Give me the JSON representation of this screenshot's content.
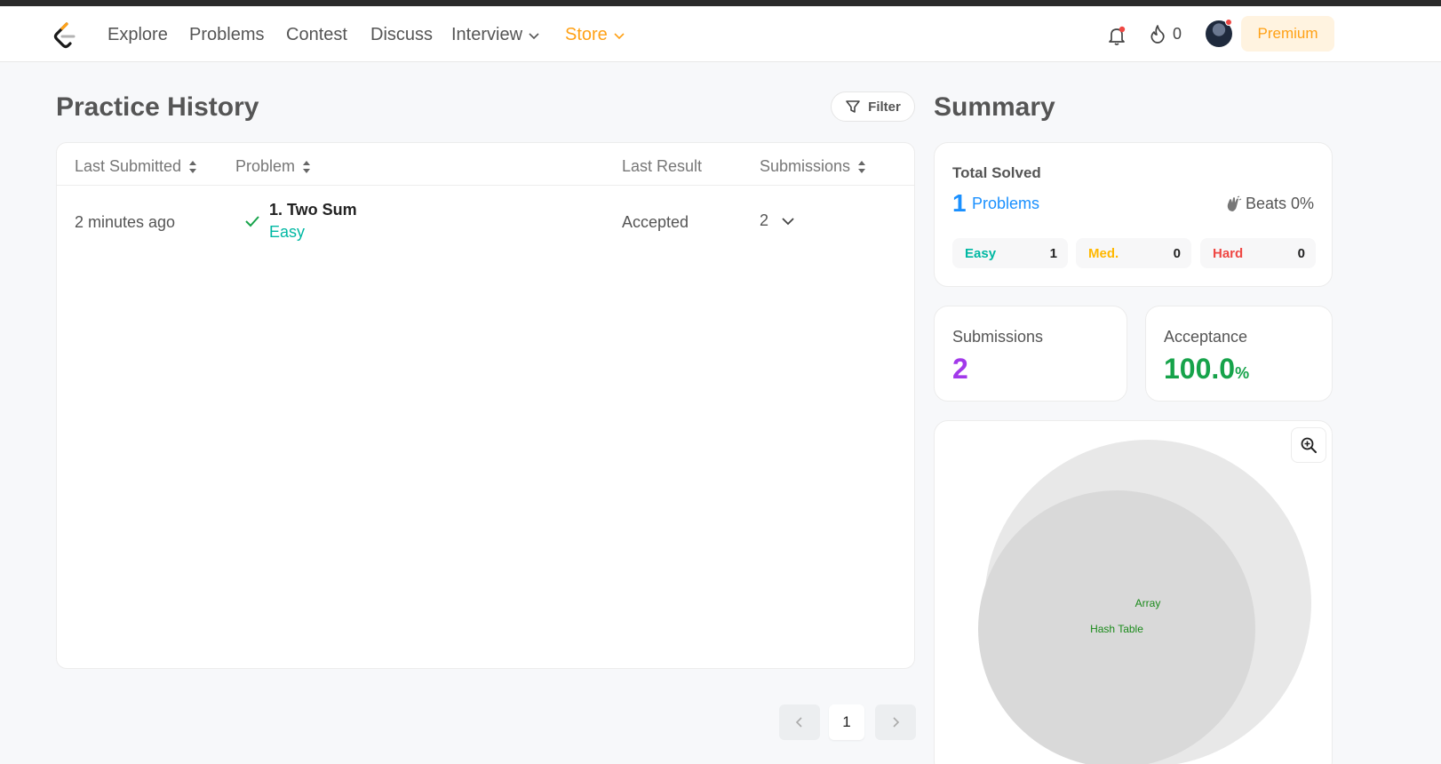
{
  "nav": {
    "items": [
      {
        "label": "Explore"
      },
      {
        "label": "Problems"
      },
      {
        "label": "Contest"
      },
      {
        "label": "Discuss"
      },
      {
        "label": "Interview"
      },
      {
        "label": "Store"
      }
    ],
    "streak_count": "0",
    "premium_label": "Premium"
  },
  "history": {
    "title": "Practice History",
    "filter_label": "Filter",
    "columns": {
      "last_submitted": "Last Submitted",
      "problem": "Problem",
      "last_result": "Last Result",
      "submissions": "Submissions"
    },
    "rows": [
      {
        "last_submitted": "2 minutes ago",
        "problem_title": "1. Two Sum",
        "difficulty": "Easy",
        "last_result": "Accepted",
        "submissions": "2"
      }
    ],
    "pagination": {
      "current_page": "1"
    }
  },
  "summary": {
    "title": "Summary",
    "total_solved": {
      "label": "Total Solved",
      "count": "1",
      "unit": "Problems",
      "beats": "Beats 0%"
    },
    "difficulty": [
      {
        "label": "Easy",
        "count": "1",
        "color": "#00b8a3"
      },
      {
        "label": "Med.",
        "count": "0",
        "color": "#ffb800"
      },
      {
        "label": "Hard",
        "count": "0",
        "color": "#ef4743"
      }
    ],
    "submissions": {
      "label": "Submissions",
      "value": "2",
      "color": "#a239ea"
    },
    "acceptance": {
      "label": "Acceptance",
      "value": "100.0",
      "unit": "%",
      "color": "#16a34a"
    },
    "tags": [
      "Array",
      "Hash Table"
    ]
  },
  "colors": {
    "brand": "#ffa116",
    "link": "#1a90ff",
    "easy": "#00b8a3",
    "tag_text": "#1a8a1a"
  }
}
